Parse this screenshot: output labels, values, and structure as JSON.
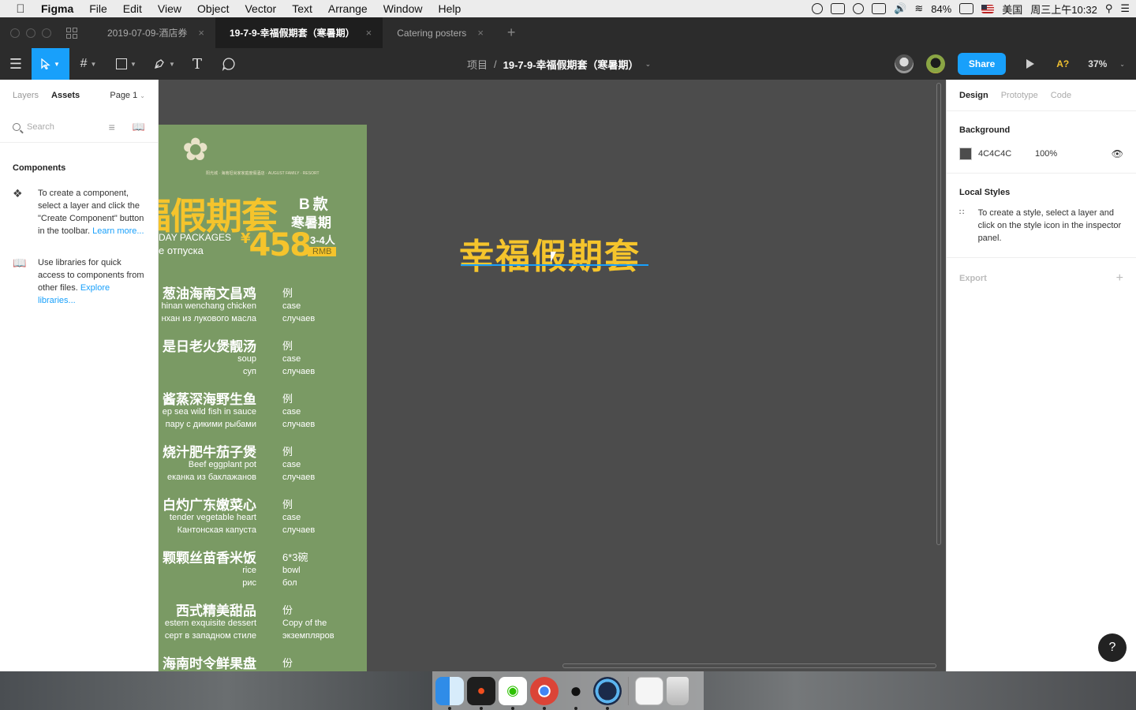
{
  "menubar": {
    "apple": "",
    "app_name": "Figma",
    "items": [
      "File",
      "Edit",
      "View",
      "Object",
      "Vector",
      "Text",
      "Arrange",
      "Window",
      "Help"
    ],
    "battery": "84%",
    "input_source": "美国",
    "clock": "周三上午10:32"
  },
  "tabs": {
    "items": [
      {
        "label": "2019-07-09-酒店券"
      },
      {
        "label": "19-7-9-幸福假期套（寒暑期）"
      },
      {
        "label": "Catering posters"
      }
    ],
    "add": "+"
  },
  "toolbar": {
    "breadcrumb_project": "项目",
    "breadcrumb_sep": "/",
    "file_name": "19-7-9-幸福假期套（寒暑期）",
    "share_label": "Share",
    "help_label": "A?",
    "zoom": "37%"
  },
  "left_panel": {
    "tab_layers": "Layers",
    "tab_assets": "Assets",
    "page": "Page 1",
    "search_placeholder": "Search",
    "components_heading": "Components",
    "components_text": "To create a component, select a layer and click the \"Create Component\" button in the toolbar.",
    "learn_more": "Learn more...",
    "libraries_text": "Use libraries for quick access to components from other files.",
    "explore_libraries": "Explore libraries..."
  },
  "poster": {
    "logo_text": "阳光城 · 海南坦尚家家庭度假酒店 · AUGUST FAMILY · RESORT",
    "title": "福假期套",
    "b_kuan": "B款",
    "summer": "寒暑期",
    "eng_pkg": "DAY PACKAGES",
    "ru_pkg": "е отпуска",
    "price_symbol": "¥",
    "price": "458",
    "people": "3-4人",
    "rmb": "RMB",
    "dishes": [
      {
        "cn": "葱油海南文昌鸡",
        "en": "hinan wenchang chicken",
        "ru": "нхан из лукового масла",
        "unit": "例",
        "unit_en": "case",
        "unit_ru": "случаев"
      },
      {
        "cn": "是日老火煲靓汤",
        "en": "soup",
        "ru": "суп",
        "unit": "例",
        "unit_en": "case",
        "unit_ru": "случаев"
      },
      {
        "cn": "酱蒸深海野生鱼",
        "en": "ep sea wild fish in sauce",
        "ru": "пару с дикими рыбами",
        "unit": "例",
        "unit_en": "case",
        "unit_ru": "случаев"
      },
      {
        "cn": "烧汁肥牛茄子煲",
        "en": "Beef eggplant pot",
        "ru": "еканка из баклажанов",
        "unit": "例",
        "unit_en": "case",
        "unit_ru": "случаев"
      },
      {
        "cn": "白灼广东嫩菜心",
        "en": "tender vegetable heart",
        "ru": "Кантонская капуста",
        "unit": "例",
        "unit_en": "case",
        "unit_ru": "случаев"
      },
      {
        "cn": "颗颗丝苗香米饭",
        "en": "rice",
        "ru": "рис",
        "unit": "6*3碗",
        "unit_en": "bowl",
        "unit_ru": "бол"
      },
      {
        "cn": "西式精美甜品",
        "en": "estern exquisite dessert",
        "ru": "серт в западном стиле",
        "unit": "份",
        "unit_en": "Copy of the",
        "unit_ru": "экземпляров"
      },
      {
        "cn": "海南时令鲜果盘",
        "en": "",
        "ru": "",
        "unit": "份",
        "unit_en": "",
        "unit_ru": ""
      }
    ]
  },
  "canvas_text": "幸福假期套",
  "right_panel": {
    "tab_design": "Design",
    "tab_prototype": "Prototype",
    "tab_code": "Code",
    "background_heading": "Background",
    "bg_hex": "4C4C4C",
    "bg_opacity": "100%",
    "local_styles_heading": "Local Styles",
    "local_styles_text": "To create a style, select a layer and click on the style icon in the inspector panel.",
    "export_label": "Export",
    "export_plus": "+",
    "help": "?"
  },
  "colors": {
    "accent": "#18a0fb",
    "poster_green": "#7a9a64",
    "poster_yellow": "#f5c42c",
    "canvas_bg": "#4c4c4c"
  }
}
